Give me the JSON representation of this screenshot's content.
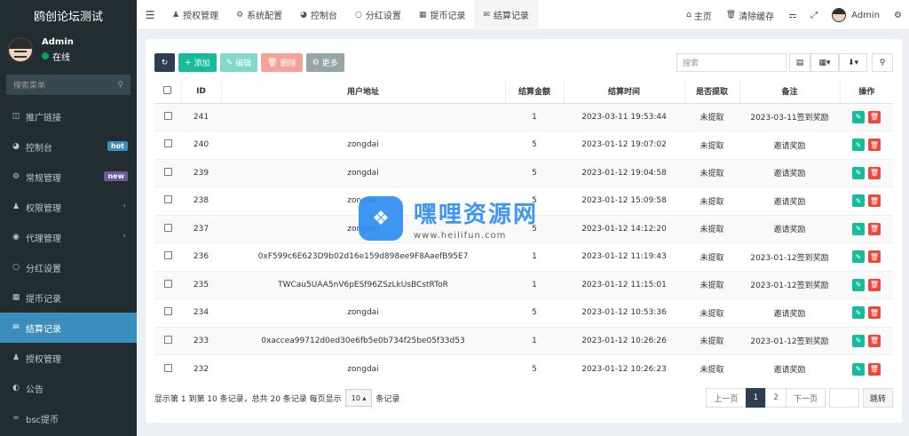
{
  "app": {
    "title": "鸥创论坛测试"
  },
  "user": {
    "name": "Admin",
    "status": "在线"
  },
  "sidebar": {
    "search_placeholder": "搜索菜单",
    "items": [
      {
        "label": "推广链接",
        "icon": "link-icon"
      },
      {
        "label": "控制台",
        "icon": "dashboard-icon",
        "badge": "hot"
      },
      {
        "label": "常规管理",
        "icon": "cogs-icon",
        "badge": "new"
      },
      {
        "label": "权限管理",
        "icon": "group-icon"
      },
      {
        "label": "代理管理",
        "icon": "user-circle-icon"
      },
      {
        "label": "分红设置",
        "icon": "circle-icon"
      },
      {
        "label": "提币记录",
        "icon": "building-icon"
      },
      {
        "label": "结算记录",
        "icon": "envelope-icon",
        "active": true
      },
      {
        "label": "授权管理",
        "icon": "group-icon"
      },
      {
        "label": "公告",
        "icon": "half-circle-icon"
      },
      {
        "label": "bsc提币",
        "icon": "bicycle-icon"
      }
    ]
  },
  "navbar": {
    "tabs": [
      {
        "label": "授权管理"
      },
      {
        "label": "系统配置"
      },
      {
        "label": "控制台"
      },
      {
        "label": "分红设置"
      },
      {
        "label": "提币记录"
      },
      {
        "label": "结算记录"
      }
    ],
    "home": "主页",
    "clear_cache": "清除缓存",
    "admin": "Admin"
  },
  "toolbar": {
    "add": "添加",
    "edit": "编辑",
    "delete": "删除",
    "more": "更多",
    "search_placeholder": "搜索"
  },
  "table": {
    "headers": [
      "ID",
      "用户地址",
      "结算金额",
      "结算时间",
      "是否提取",
      "备注",
      "操作"
    ],
    "rows": [
      {
        "id": "241",
        "address": "",
        "amount": "1",
        "time": "2023-03-11 19:53:44",
        "extracted": "未提取",
        "note": "2023-03-11签到奖励"
      },
      {
        "id": "240",
        "address": "zongdai",
        "amount": "5",
        "time": "2023-01-12 19:07:02",
        "extracted": "未提取",
        "note": "邀请奖励"
      },
      {
        "id": "239",
        "address": "zongdai",
        "amount": "5",
        "time": "2023-01-12 19:04:58",
        "extracted": "未提取",
        "note": "邀请奖励"
      },
      {
        "id": "238",
        "address": "zongdai",
        "amount": "5",
        "time": "2023-01-12 15:09:58",
        "extracted": "未提取",
        "note": "邀请奖励"
      },
      {
        "id": "237",
        "address": "zongdai",
        "amount": "5",
        "time": "2023-01-12 14:12:20",
        "extracted": "未提取",
        "note": "邀请奖励"
      },
      {
        "id": "236",
        "address": "0xF599c6E623D9b02d16e159d898ee9F8AaefB95E7",
        "amount": "1",
        "time": "2023-01-12 11:19:43",
        "extracted": "未提取",
        "note": "2023-01-12签到奖励"
      },
      {
        "id": "235",
        "address": "TWCau5UAA5nV6pESf96ZSzLkUsBCstRToR",
        "amount": "1",
        "time": "2023-01-12 11:15:01",
        "extracted": "未提取",
        "note": "2023-01-12签到奖励"
      },
      {
        "id": "234",
        "address": "zongdai",
        "amount": "5",
        "time": "2023-01-12 10:53:36",
        "extracted": "未提取",
        "note": "邀请奖励"
      },
      {
        "id": "233",
        "address": "0xaccea99712d0ed30e6fb5e0b734f25be05f33d53",
        "amount": "1",
        "time": "2023-01-12 10:26:26",
        "extracted": "未提取",
        "note": "2023-01-12签到奖励"
      },
      {
        "id": "232",
        "address": "zongdai",
        "amount": "5",
        "time": "2023-01-12 10:26:23",
        "extracted": "未提取",
        "note": "邀请奖励"
      }
    ]
  },
  "footer": {
    "info": "显示第 1 到第 10 条记录，总共 20 条记录 每页显示",
    "page_size": "10",
    "info_suffix": "条记录",
    "prev": "上一页",
    "pages": [
      "1",
      "2"
    ],
    "next": "下一页",
    "jump": "跳转"
  },
  "watermark": {
    "title": "嘿哩资源网",
    "url": "www.heilifun.com"
  },
  "colors": {
    "sidebar": "#222d32",
    "active": "#3c8dbc",
    "success": "#18bc9c",
    "danger": "#e74c3c",
    "primary_dark": "#2c3e50"
  }
}
